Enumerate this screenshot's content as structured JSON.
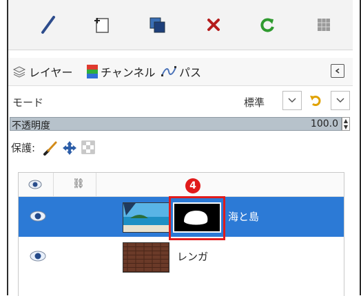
{
  "toolbar": {
    "buttons": [
      {
        "icon": "pencil-icon"
      },
      {
        "icon": "new-layer-icon"
      },
      {
        "icon": "duplicate-layer-icon"
      },
      {
        "icon": "delete-icon"
      },
      {
        "icon": "refresh-icon"
      },
      {
        "icon": "grid-icon"
      }
    ]
  },
  "tabs": {
    "items": [
      {
        "label": "レイヤー",
        "icon": "layers-icon"
      },
      {
        "label": "チャンネル",
        "icon": "channels-icon"
      },
      {
        "label": "パス",
        "icon": "paths-icon"
      }
    ]
  },
  "mode": {
    "label": "モード",
    "value": "標準"
  },
  "opacity": {
    "label": "不透明度",
    "value": "100.0"
  },
  "lock": {
    "label": "保護:"
  },
  "layers": {
    "header_chain": "⛓",
    "items": [
      {
        "name": "海と島",
        "selected": true
      },
      {
        "name": "レンガ",
        "selected": false
      }
    ]
  },
  "annotation": {
    "badge": "4"
  },
  "colors": {
    "selection": "#2c7ad6",
    "annotation": "#e11b1b"
  }
}
